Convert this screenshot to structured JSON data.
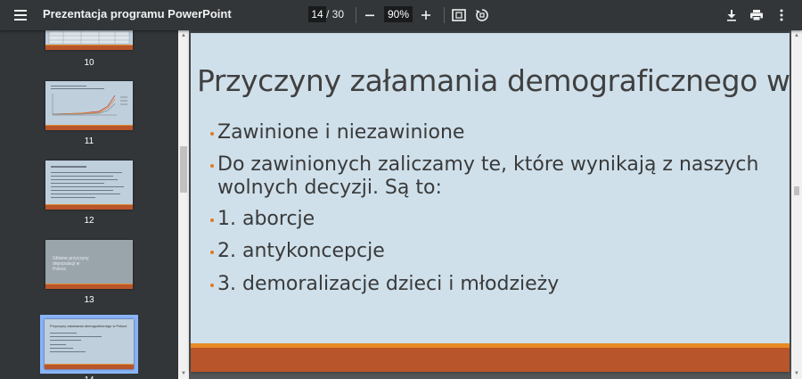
{
  "toolbar": {
    "title": "Prezentacja programu PowerPoint",
    "current_page": "14",
    "page_separator": "/ 30",
    "zoom": "90%",
    "icons": [
      "menu-icon",
      "zoom-out-icon",
      "zoom-in-icon",
      "fit-page-icon",
      "rotate-icon",
      "download-icon",
      "print-icon",
      "more-vert-icon"
    ]
  },
  "sidebar": {
    "thumbnails": [
      {
        "number": "10"
      },
      {
        "number": "11"
      },
      {
        "number": "12"
      },
      {
        "number": "13",
        "text": "Główne przyczyny depopulacji w Polsce"
      },
      {
        "number": "14"
      }
    ]
  },
  "slide": {
    "title": "Przyczyny załamania demograficznego w Polsce",
    "bullets": [
      "Zawinione i niezawinione",
      "Do zawinionych zaliczamy te, które wynikają z naszych",
      "wolnych decyzji. Są to:",
      "1. aborcje",
      "2. antykoncepcje",
      "3. demoralizacje dzieci i młodzieży"
    ]
  },
  "colors": {
    "accent": "#e88a25",
    "band": "#b9552a",
    "slide_bg": "#cfe0eb",
    "toolbar": "#323639"
  }
}
